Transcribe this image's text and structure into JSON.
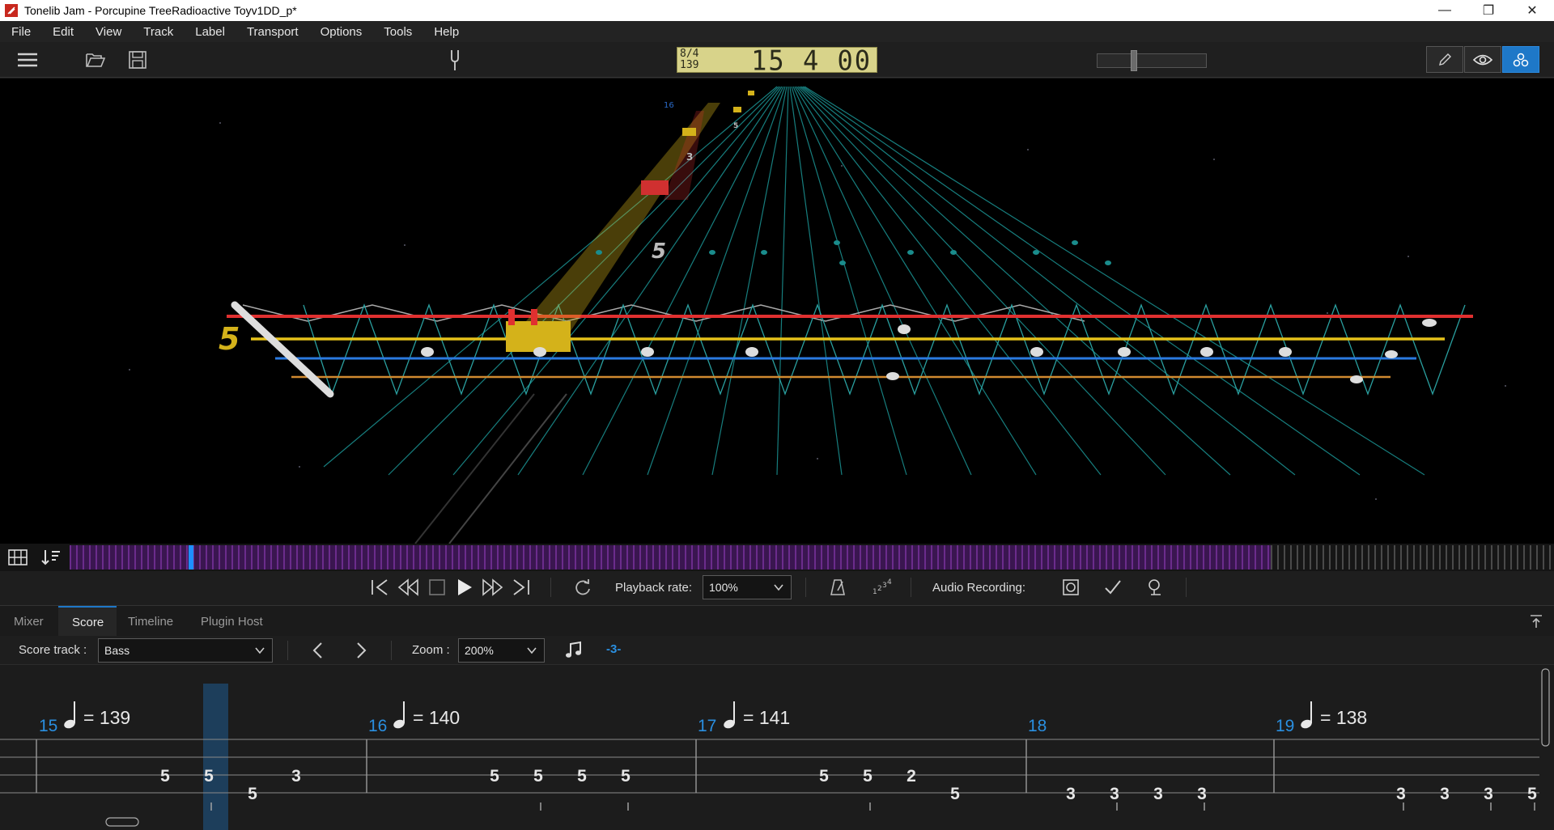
{
  "window": {
    "title": "Tonelib Jam - Porcupine TreeRadioactive Toyv1DD_p*",
    "minimize": "—",
    "restore": "❐",
    "close": "✕"
  },
  "menu": [
    "File",
    "Edit",
    "View",
    "Track",
    "Label",
    "Transport",
    "Options",
    "Tools",
    "Help"
  ],
  "lcd": {
    "time_signature": "8/4",
    "tempo": "139",
    "position": "15 4 00"
  },
  "progress": {
    "volume_fraction": 0.33
  },
  "three_d": {
    "fret_label_near": "5",
    "fret_label_mid": "5",
    "fret_label_far": "3",
    "fret_label_far2": "5",
    "fret_label_top": "16"
  },
  "transport": {
    "playback_rate_label": "Playback rate:",
    "playback_rate_value": "100%",
    "audio_recording_label": "Audio Recording:"
  },
  "tabs": [
    "Mixer",
    "Score",
    "Timeline",
    "Plugin Host"
  ],
  "active_tab": "Score",
  "score_toolbar": {
    "score_track_label": "Score track :",
    "score_track_value": "Bass",
    "zoom_label": "Zoom :",
    "zoom_value": "200%",
    "tuplet": "-3-"
  },
  "score": {
    "measures": [
      {
        "number": "15",
        "tempo": "= 139"
      },
      {
        "number": "16",
        "tempo": "= 140"
      },
      {
        "number": "17",
        "tempo": "= 141"
      },
      {
        "number": "18",
        "tempo": ""
      },
      {
        "number": "19",
        "tempo": "= 138"
      }
    ],
    "notes_row_a": [
      "5",
      "5",
      "3",
      "5",
      "5",
      "5",
      "5",
      "5",
      "5",
      "2"
    ],
    "notes_row_b": [
      "5",
      "5",
      "3",
      "3",
      "3",
      "3",
      "3",
      "3",
      "3",
      "5"
    ]
  },
  "colors": {
    "accent": "#1e78c8",
    "measure_number": "#2a8fe0",
    "string_red": "#e03030",
    "string_yellow": "#e6c21a",
    "string_blue": "#2a7ae0",
    "string_orange": "#d08a30",
    "fret_wire": "#20a0a0",
    "timeline_bar": "#6b2c8c"
  },
  "icons": [
    "menu-icon",
    "folder-open-icon",
    "save-icon",
    "tuning-fork-icon",
    "pencil-icon",
    "eye-icon",
    "network-icon",
    "grid-icon",
    "sort-icon",
    "skip-start-icon",
    "rewind-icon",
    "stop-icon",
    "play-icon",
    "fast-forward-icon",
    "skip-end-icon",
    "loop-icon",
    "metronome-icon",
    "count-in-icon",
    "record-icon",
    "check-icon",
    "record-settings-icon",
    "note-icon",
    "collapse-icon"
  ]
}
